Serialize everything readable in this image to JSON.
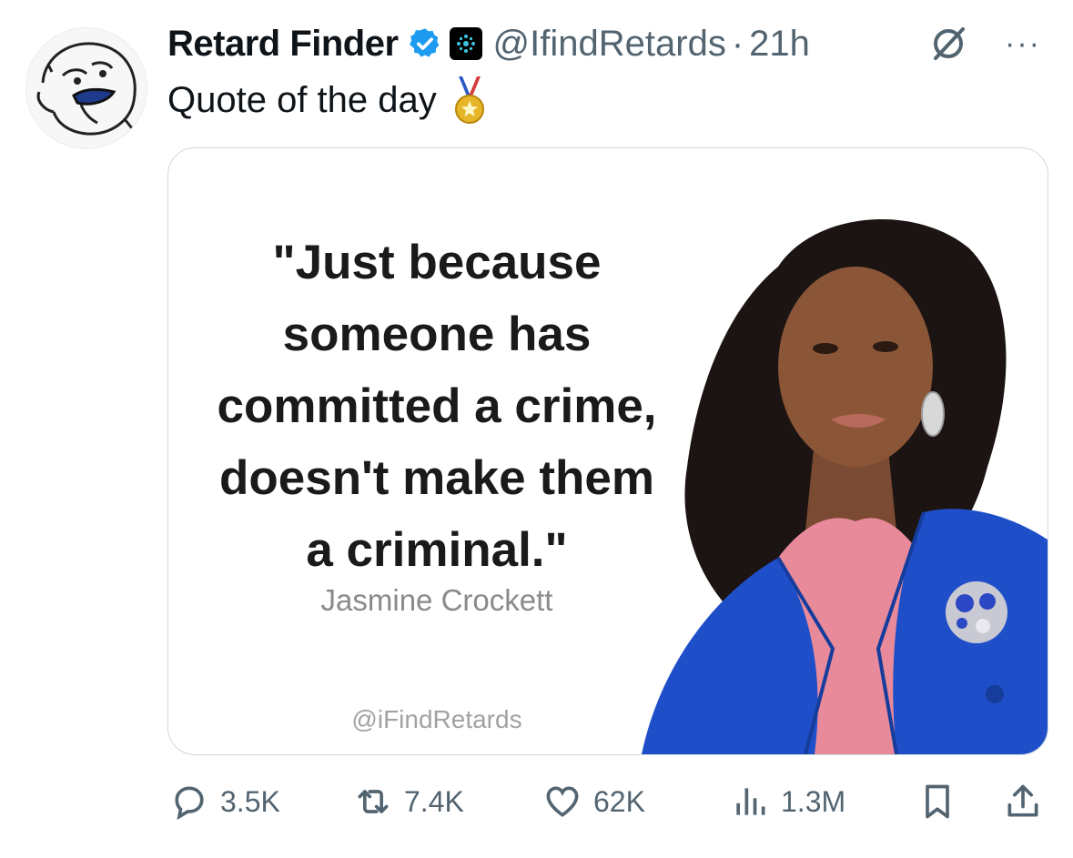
{
  "tweet": {
    "display_name": "Retard Finder",
    "handle": "@IfindRetards",
    "separator": "·",
    "time": "21h",
    "text": "Quote of the day",
    "more_label": "···"
  },
  "media": {
    "quote_lines": [
      "\"Just because",
      "someone has",
      "committed a crime,",
      "doesn't make them",
      "a criminal.\""
    ],
    "author": "Jasmine Crockett",
    "watermark": "@iFindRetards"
  },
  "actions": {
    "replies": "3.5K",
    "reposts": "7.4K",
    "likes": "62K",
    "views": "1.3M"
  },
  "colors": {
    "verified": "#1d9bf0",
    "secondary_text": "#536471",
    "blazer": "#1f4fc8",
    "blouse": "#e88a9a",
    "medal_gold": "#e7b528"
  }
}
